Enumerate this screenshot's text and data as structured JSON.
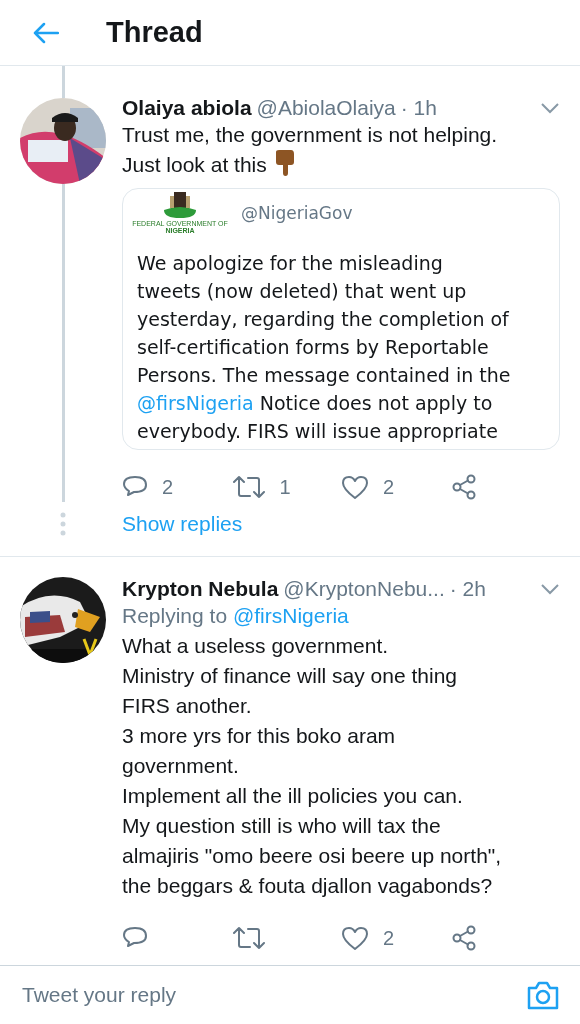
{
  "header": {
    "title": "Thread"
  },
  "tweets": [
    {
      "name": "Olaiya abiola",
      "handle": "@AbiolaOlaiya",
      "time": "· 1h",
      "text": "Trust me, the government is not helping.\nJust look at this",
      "pointing_emoji": true,
      "quote": {
        "logo_caption": "FEDERAL GOVERNMENT OF",
        "logo_name": "NIGERIA",
        "handle": "@NigeriaGov",
        "text_before": "We apologize for the misleading\ntweets (now deleted) that went up\nyesterday, regarding the completion of\nself-certification forms by Reportable\nPersons. The message contained in the\n",
        "mention": "@firsNigeria",
        "text_after": " Notice does not apply to\neverybody. FIRS will issue appropriate"
      },
      "actions": {
        "replies": "2",
        "retweets": "1",
        "likes": "2"
      },
      "thread_line": true,
      "show_replies": "Show replies"
    },
    {
      "name": "Krypton Nebula",
      "handle": "@KryptonNebu...",
      "time": "· 2h",
      "replying_label": "Replying to",
      "replying_to": "@firsNigeria",
      "text": "What a useless government.\nMinistry of finance will say one thing\nFIRS another.\n3 more yrs for this boko aram\ngovernment.\nImplement all the ill policies you can.\nMy question still is who will tax the\nalmajiris \"omo beere osi beere up north\",\nthe beggars & fouta djallon vagabonds?",
      "pointing_emoji": false,
      "actions": {
        "likes": "2"
      },
      "thread_line": false
    }
  ],
  "reply_bar": {
    "placeholder": "Tweet your reply"
  }
}
